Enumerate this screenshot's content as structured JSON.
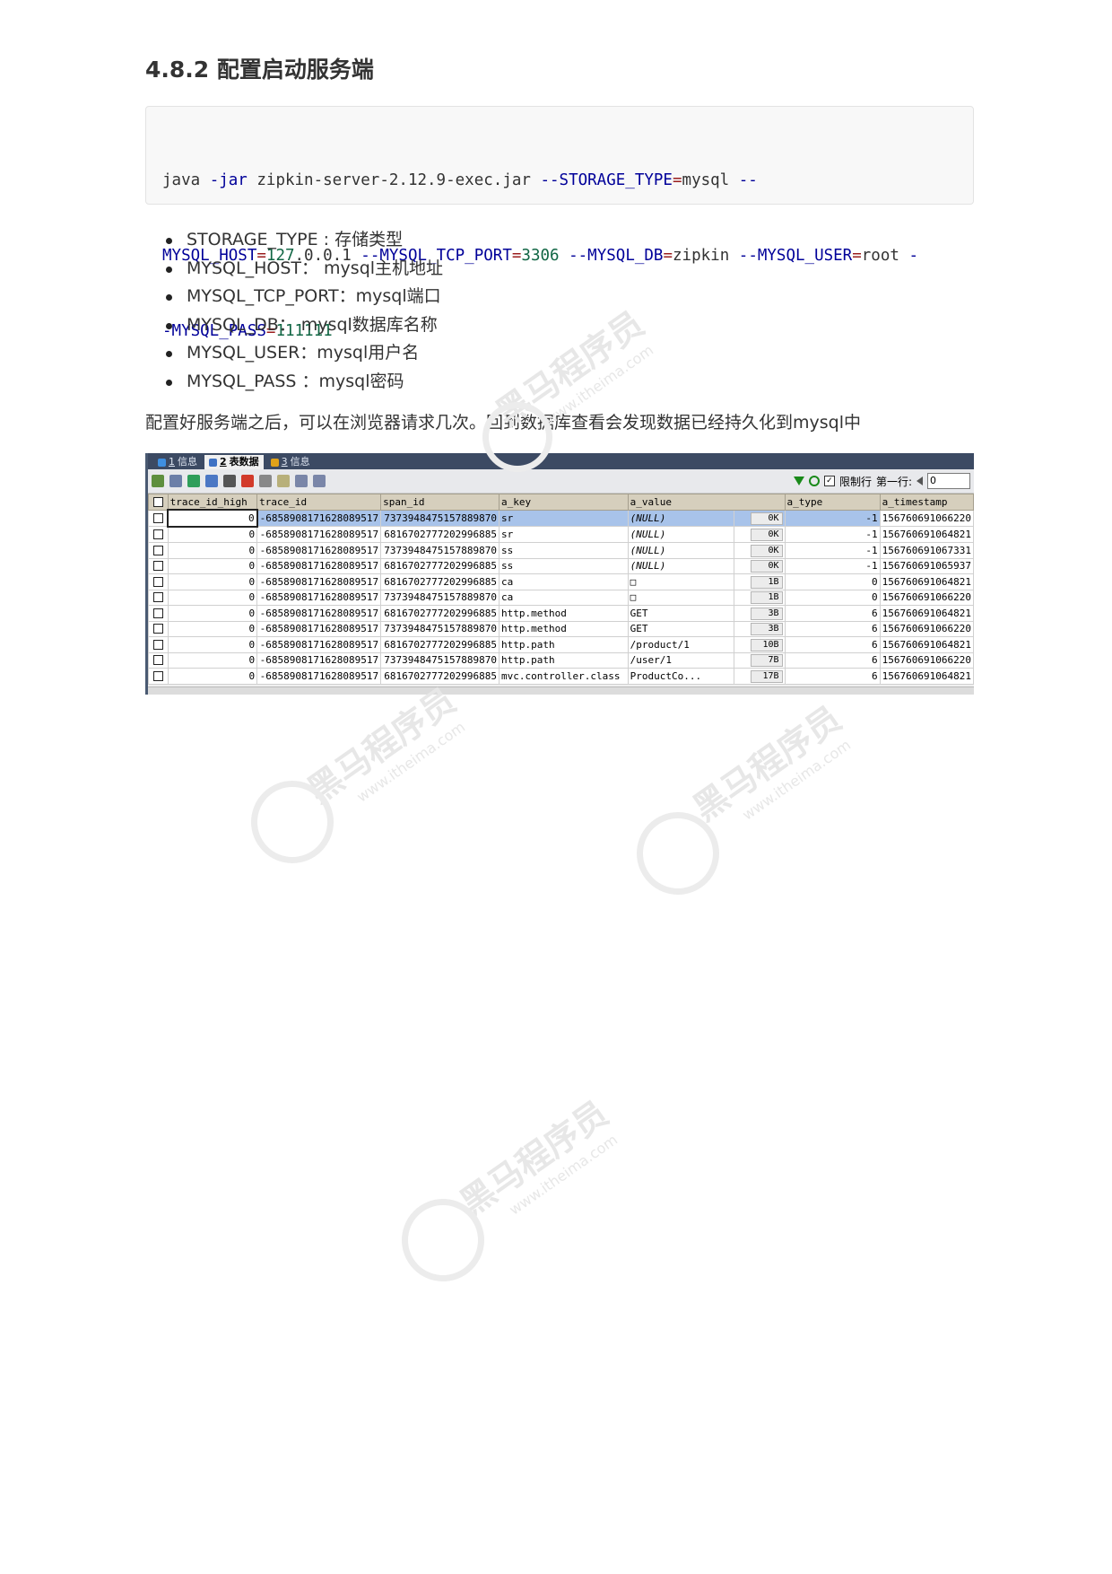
{
  "heading": "4.8.2 配置启动服务端",
  "code": {
    "line1": [
      {
        "t": "java ",
        "c": ""
      },
      {
        "t": "-jar",
        "c": "kw"
      },
      {
        "t": " zipkin-server-2.12.9-exec.jar ",
        "c": ""
      },
      {
        "t": "--STORAGE_TYPE",
        "c": "kw"
      },
      {
        "t": "=",
        "c": "op"
      },
      {
        "t": "mysql ",
        "c": ""
      },
      {
        "t": "--",
        "c": "kw"
      }
    ],
    "line2": [
      {
        "t": "MYSQL_HOST",
        "c": "kw"
      },
      {
        "t": "=",
        "c": "op"
      },
      {
        "t": "127",
        "c": "num"
      },
      {
        "t": ".0.0.1 ",
        "c": ""
      },
      {
        "t": "--MYSQL_TCP_PORT",
        "c": "kw"
      },
      {
        "t": "=",
        "c": "op"
      },
      {
        "t": "3306",
        "c": "num"
      },
      {
        "t": " ",
        "c": ""
      },
      {
        "t": "--MYSQL_DB",
        "c": "kw"
      },
      {
        "t": "=",
        "c": "op"
      },
      {
        "t": "zipkin ",
        "c": ""
      },
      {
        "t": "--MYSQL_USER",
        "c": "kw"
      },
      {
        "t": "=",
        "c": "op"
      },
      {
        "t": "root ",
        "c": ""
      },
      {
        "t": "-",
        "c": "kw"
      }
    ],
    "line3": [
      {
        "t": "-MYSQL_PASS",
        "c": "kw"
      },
      {
        "t": "=",
        "c": "op"
      },
      {
        "t": "111111",
        "c": "num"
      }
    ]
  },
  "params": [
    "STORAGE_TYPE : 存储类型",
    "MYSQL_HOST： mysql主机地址",
    "MYSQL_TCP_PORT：mysql端口",
    "MYSQL_DB： mysql数据库名称",
    "MYSQL_USER：mysql用户名",
    "MYSQL_PASS ：mysql密码"
  ],
  "note": "配置好服务端之后，可以在浏览器请求几次。回到数据库查看会发现数据已经持久化到mysql中",
  "db_tool": {
    "tabs": [
      {
        "num": "1",
        "label": "信息",
        "active": false,
        "color": "#3f8fe0"
      },
      {
        "num": "2",
        "label": "表数据",
        "active": true,
        "color": "#3f72c4"
      },
      {
        "num": "3",
        "label": "信息",
        "active": false,
        "color": "#e0a21a"
      }
    ],
    "limit_label": "限制行",
    "first_row_label": "第一行:",
    "first_row_value": "0",
    "columns": [
      "trace_id_high",
      "trace_id",
      "span_id",
      "a_key",
      "a_value",
      "a_type",
      "a_timestamp"
    ],
    "rows": [
      {
        "trace_id_high": "0",
        "trace_id": "-6858908171628089517",
        "span_id": "7373948475157889870",
        "a_key": "sr",
        "a_value": "(NULL)",
        "len": "0K",
        "a_type": "-1",
        "a_timestamp": "156760691066220"
      },
      {
        "trace_id_high": "0",
        "trace_id": "-6858908171628089517",
        "span_id": "6816702777202996885",
        "a_key": "sr",
        "a_value": "(NULL)",
        "len": "0K",
        "a_type": "-1",
        "a_timestamp": "156760691064821"
      },
      {
        "trace_id_high": "0",
        "trace_id": "-6858908171628089517",
        "span_id": "7373948475157889870",
        "a_key": "ss",
        "a_value": "(NULL)",
        "len": "0K",
        "a_type": "-1",
        "a_timestamp": "156760691067331"
      },
      {
        "trace_id_high": "0",
        "trace_id": "-6858908171628089517",
        "span_id": "6816702777202996885",
        "a_key": "ss",
        "a_value": "(NULL)",
        "len": "0K",
        "a_type": "-1",
        "a_timestamp": "156760691065937"
      },
      {
        "trace_id_high": "0",
        "trace_id": "-6858908171628089517",
        "span_id": "6816702777202996885",
        "a_key": "ca",
        "a_value": "□",
        "len": "1B",
        "a_type": "0",
        "a_timestamp": "156760691064821"
      },
      {
        "trace_id_high": "0",
        "trace_id": "-6858908171628089517",
        "span_id": "7373948475157889870",
        "a_key": "ca",
        "a_value": "□",
        "len": "1B",
        "a_type": "0",
        "a_timestamp": "156760691066220"
      },
      {
        "trace_id_high": "0",
        "trace_id": "-6858908171628089517",
        "span_id": "6816702777202996885",
        "a_key": "http.method",
        "a_value": "GET",
        "len": "3B",
        "a_type": "6",
        "a_timestamp": "156760691064821"
      },
      {
        "trace_id_high": "0",
        "trace_id": "-6858908171628089517",
        "span_id": "7373948475157889870",
        "a_key": "http.method",
        "a_value": "GET",
        "len": "3B",
        "a_type": "6",
        "a_timestamp": "156760691066220"
      },
      {
        "trace_id_high": "0",
        "trace_id": "-6858908171628089517",
        "span_id": "6816702777202996885",
        "a_key": "http.path",
        "a_value": "/product/1",
        "len": "10B",
        "a_type": "6",
        "a_timestamp": "156760691064821"
      },
      {
        "trace_id_high": "0",
        "trace_id": "-6858908171628089517",
        "span_id": "7373948475157889870",
        "a_key": "http.path",
        "a_value": "/user/1",
        "len": "7B",
        "a_type": "6",
        "a_timestamp": "156760691066220"
      },
      {
        "trace_id_high": "0",
        "trace_id": "-6858908171628089517",
        "span_id": "6816702777202996885",
        "a_key": "mvc.controller.class",
        "a_value": "ProductCo...",
        "len": "17B",
        "a_type": "6",
        "a_timestamp": "156760691064821"
      }
    ]
  },
  "watermark": {
    "main": "黑马程序员",
    "sub": "www.itheima.com"
  }
}
